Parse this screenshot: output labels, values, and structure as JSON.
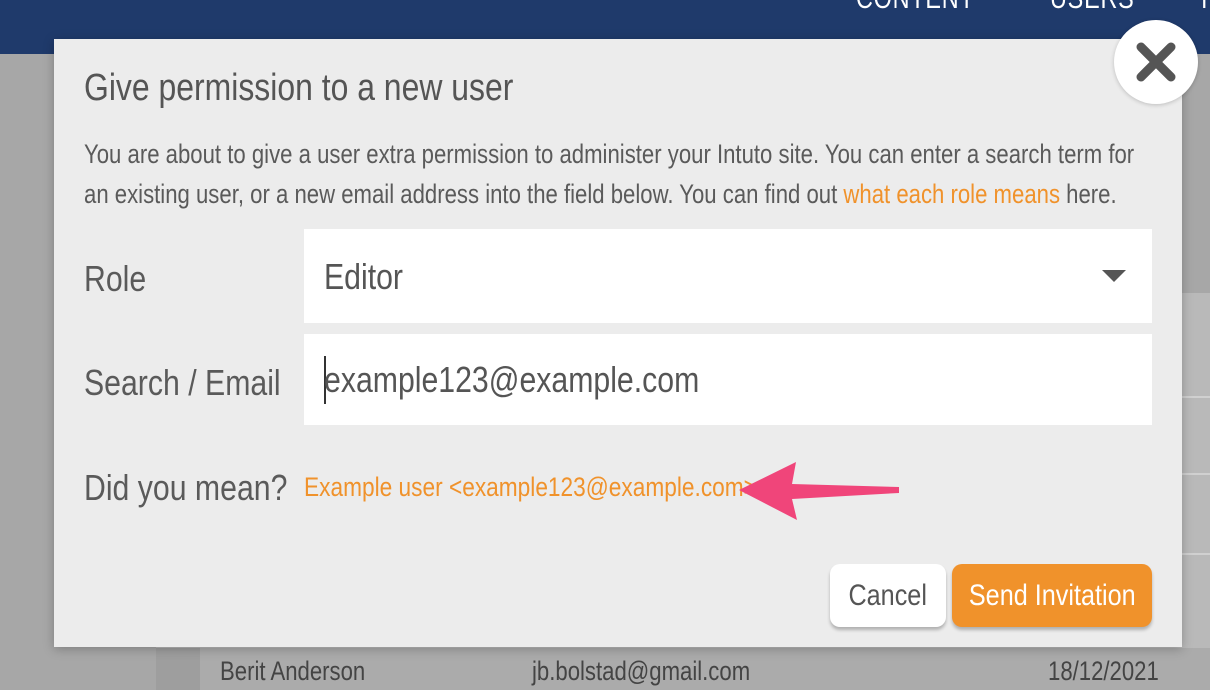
{
  "topnav": {
    "items": [
      "CONTENT",
      "USERS",
      "I"
    ]
  },
  "background_table": {
    "row": {
      "name": "Berit Anderson",
      "email": "jb.bolstad@gmail.com",
      "date": "18/12/2021"
    }
  },
  "modal": {
    "title": "Give permission to a new user",
    "description_before": "You are about to give a user extra permission to administer your Intuto site. You can enter a search term for an existing user, or a new email address into the field below. You can find out ",
    "description_link": "what each role means",
    "description_after": " here.",
    "role_label": "Role",
    "role_value": "Editor",
    "search_label": "Search / Email",
    "search_value": "example123@example.com",
    "suggest_label": "Did you mean?",
    "suggestion": "Example user <example123@example.com>",
    "cancel_label": "Cancel",
    "send_label": "Send Invitation"
  },
  "colors": {
    "accent": "#f0922b",
    "header": "#1f3a6b",
    "arrow": "#f0457a"
  },
  "icons": {
    "close": "close-icon",
    "dropdown": "caret-down-icon",
    "annotation": "arrow-annotation"
  }
}
